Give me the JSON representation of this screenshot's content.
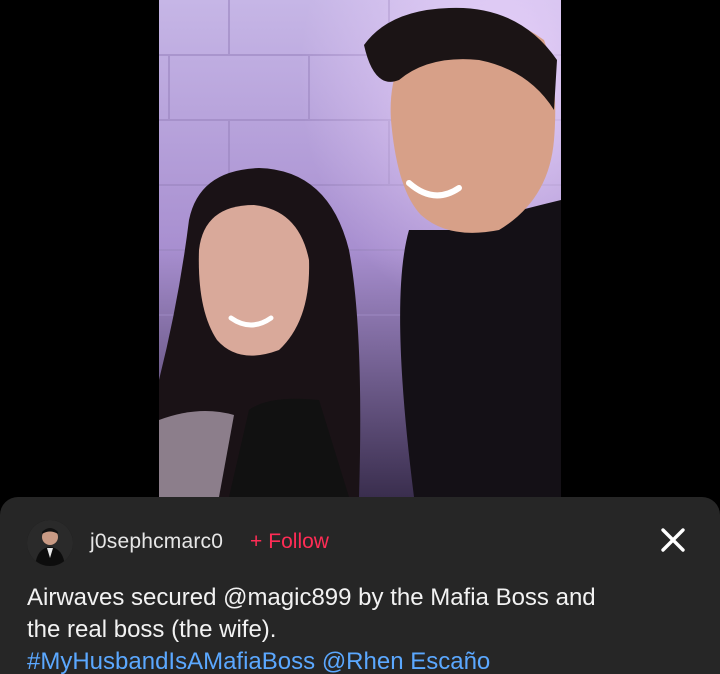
{
  "post": {
    "photo_icon": "photo-image",
    "author": {
      "username": "j0sephcmarc0",
      "avatar_icon": "avatar-icon"
    },
    "follow_plus": "+",
    "follow_label": "Follow",
    "close_icon": "close-icon",
    "caption": {
      "line1": "Airwaves secured @magic899 by the Mafia Boss and",
      "line2": "the real boss (the wife).",
      "hashtag": "#MyHusbandIsAMafiaBoss",
      "mention": "@Rhen Escaño"
    }
  },
  "colors": {
    "background": "#000000",
    "sheet": "#262626",
    "follow": "#fe2c55",
    "link": "#5ba8ff"
  }
}
